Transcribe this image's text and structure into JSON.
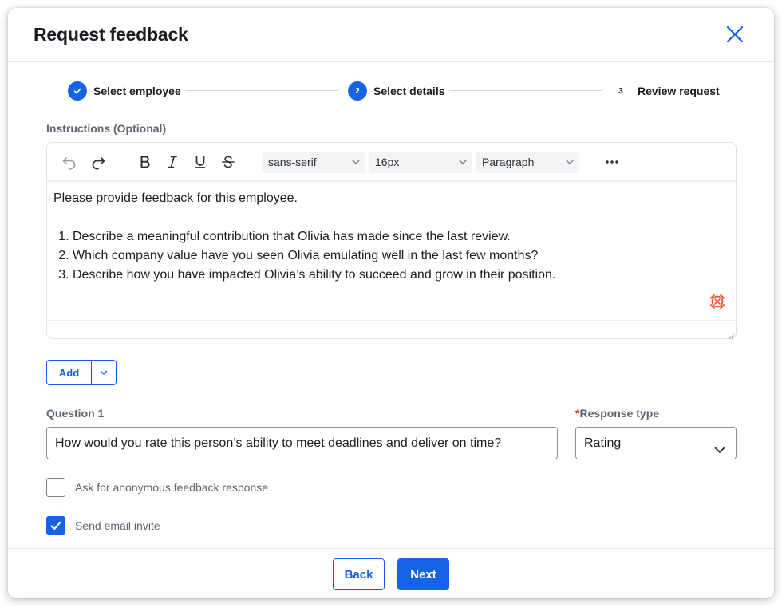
{
  "dialog": {
    "title": "Request feedback",
    "close_icon": "close-icon"
  },
  "stepper": {
    "steps": [
      {
        "number": "1",
        "label": "Select employee",
        "state": "complete"
      },
      {
        "number": "2",
        "label": "Select details",
        "state": "active"
      },
      {
        "number": "3",
        "label": "Review request",
        "state": "upcoming"
      }
    ]
  },
  "instructions": {
    "label": "Instructions (Optional)",
    "toolbar": {
      "font_family": "sans-serif",
      "font_size": "16px",
      "block_format": "Paragraph",
      "icons": [
        "undo-icon",
        "redo-icon",
        "bold-icon",
        "italic-icon",
        "underline-icon",
        "strikethrough-icon",
        "more-icon"
      ]
    },
    "intro": "Please provide feedback for this employee.",
    "items": [
      "Describe a meaningful contribution that Olivia has made since the last review.",
      "Which company value have you seen Olivia emulating well in the last few months?",
      "Describe how you have impacted Olivia’s ability to succeed and grow in their position."
    ]
  },
  "add_button": {
    "label": "Add"
  },
  "question": {
    "label": "Question 1",
    "value": "How would you rate this person’s ability to meet deadlines and deliver on time?"
  },
  "response_type": {
    "required_mark": "*",
    "label": "Response type",
    "value": "Rating"
  },
  "options": {
    "anonymous": {
      "label": "Ask for anonymous feedback response",
      "checked": false
    },
    "email_invite": {
      "label": "Send email invite",
      "checked": true
    }
  },
  "footer": {
    "back_label": "Back",
    "next_label": "Next"
  },
  "colors": {
    "primary": "#1763e6",
    "ai_accent": "#e8532f",
    "required": "#d9362b"
  }
}
